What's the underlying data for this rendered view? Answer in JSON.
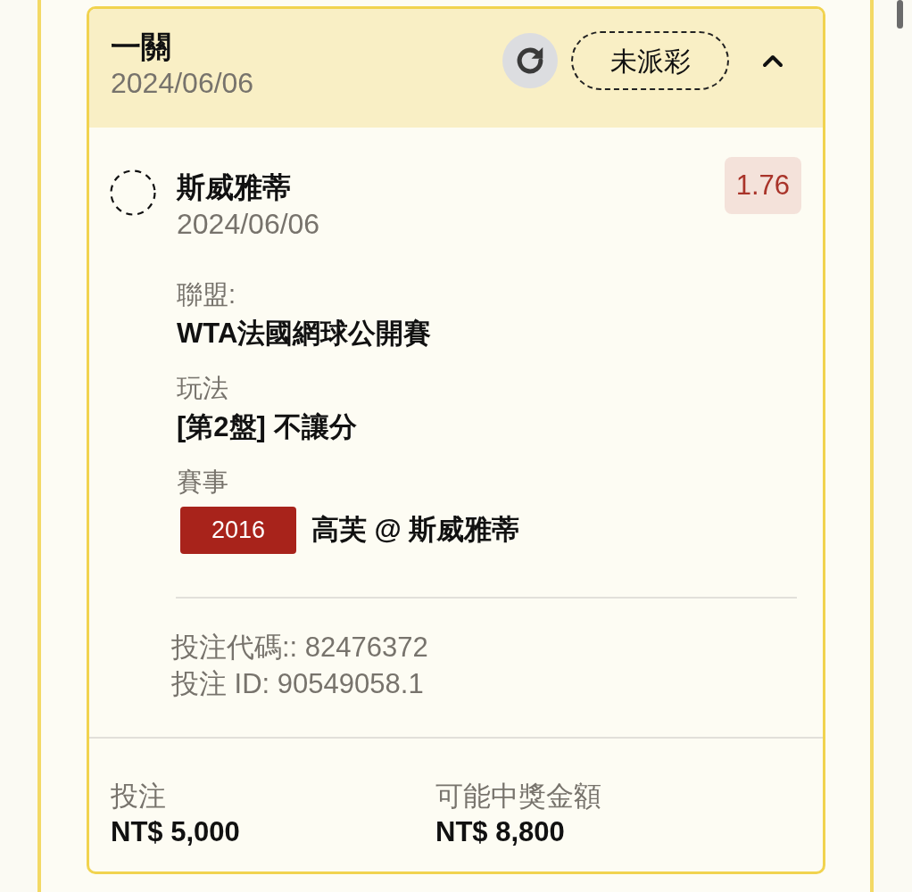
{
  "ticket": {
    "title": "一關",
    "date": "2024/06/06",
    "status": "未派彩",
    "expanded": true
  },
  "selection": {
    "name": "斯威雅蒂",
    "date": "2024/06/06",
    "odds": "1.76"
  },
  "details": [
    {
      "kind": "text",
      "label": "聯盟:",
      "value": "WTA法國網球公開賽"
    },
    {
      "kind": "text",
      "label": "玩法",
      "value": "[第2盤] 不讓分"
    },
    {
      "kind": "match",
      "label": "賽事",
      "code": "2016",
      "value": "高芙 @ 斯威雅蒂"
    }
  ],
  "references": [
    "投注代碼:: 82476372",
    "投注 ID: 90549058.1"
  ],
  "totals": [
    {
      "label": "投注",
      "value": "NT$ 5,000"
    },
    {
      "label": "可能中獎金額",
      "value": "NT$ 8,800"
    }
  ]
}
